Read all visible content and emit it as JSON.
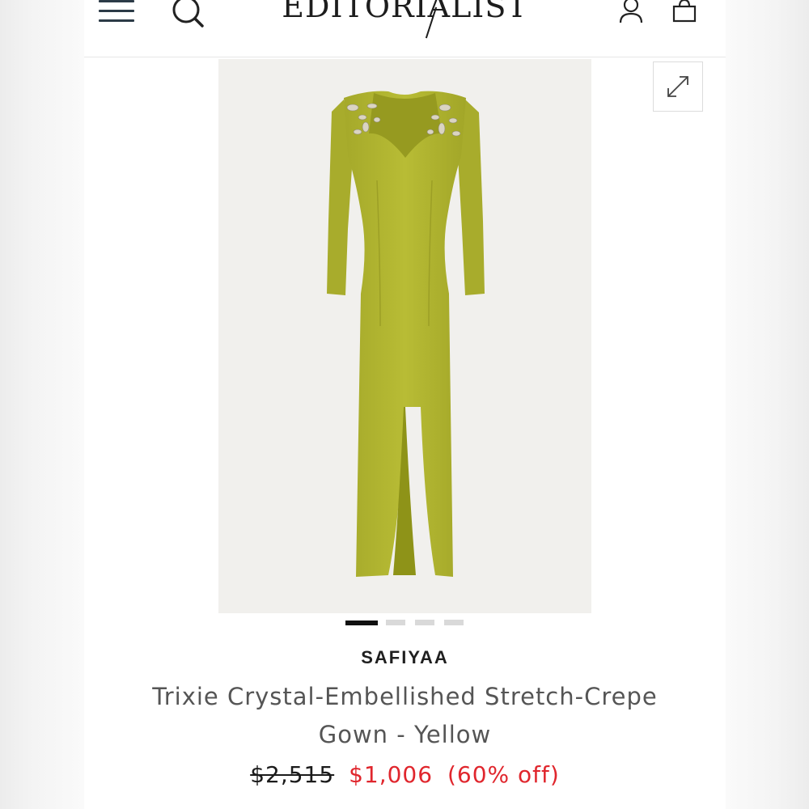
{
  "header": {
    "logo_text": "EDITORIALIST",
    "menu_icon": "hamburger-menu-icon",
    "search_icon": "search-icon",
    "account_icon": "account-icon",
    "bag_icon": "shopping-bag-icon"
  },
  "gallery": {
    "expand_icon": "expand-icon",
    "image_count": 4,
    "active_index": 0,
    "dress_color": "#b3b72f"
  },
  "product": {
    "brand": "SAFIYAA",
    "title": "Trixie Crystal-Embellished Stretch-Crepe Gown - Yellow",
    "original_price": "$2,515",
    "sale_price": "$1,006",
    "discount": "(60% off)"
  },
  "colors": {
    "sale": "#e0262d",
    "text": "#555555",
    "navy": "#2c3b47"
  }
}
